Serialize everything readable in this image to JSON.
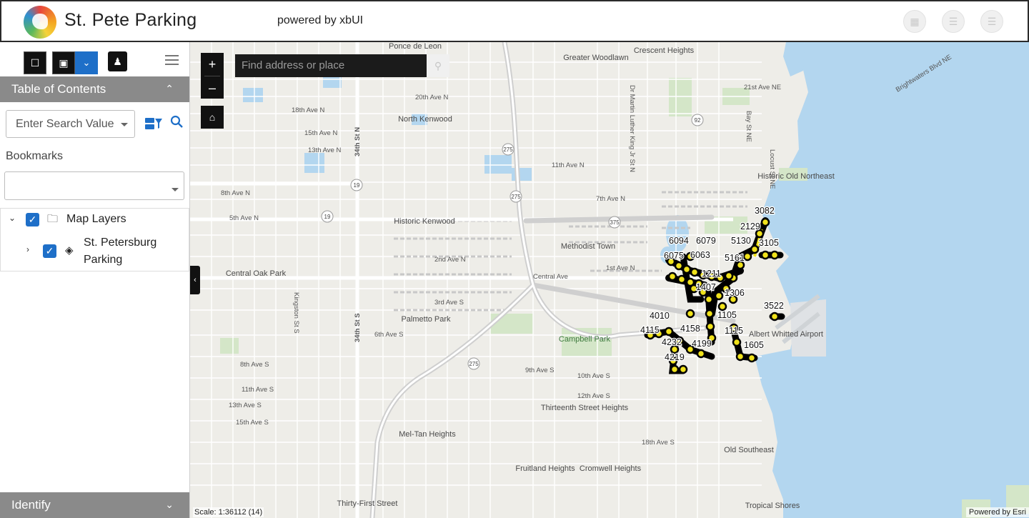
{
  "header": {
    "title": "St. Pete Parking",
    "powered_by": "powered by xbUI",
    "buttons": [
      {
        "icon": "grid-icon"
      },
      {
        "icon": "list-icon"
      },
      {
        "icon": "layers-icon"
      }
    ]
  },
  "toolbar": {
    "icons": [
      "measure-icon",
      "select-icon",
      "chevron-down-icon",
      "person-icon",
      "menu-icon"
    ]
  },
  "toc": {
    "title": "Table of Contents",
    "search_placeholder": "Enter Search Value",
    "bookmarks_label": "Bookmarks",
    "bookmark_value": "",
    "layers": [
      {
        "label": "Map Layers",
        "checked": true,
        "expanded": true
      },
      {
        "label_line1": "St. Petersburg",
        "label_line2": "Parking",
        "checked": true,
        "expanded": false
      }
    ]
  },
  "identify": {
    "title": "Identify"
  },
  "map": {
    "search_placeholder": "Find address or place",
    "zoom_in": "+",
    "zoom_out": "–",
    "scale": "Scale: 1:36112 (14)",
    "attribution": "Powered by Esri",
    "place_labels": [
      "Ponce de Leon",
      "Greater Woodlawn",
      "Crescent Heights",
      "North Kenwood",
      "Historic Old Northeast",
      "Historic Kenwood",
      "Methodist Town",
      "Central Oak Park",
      "Palmetto Park",
      "Campbell Park",
      "Albert Whitted Airport",
      "Thirteenth Street Heights",
      "Mel-Tan Heights",
      "Fruitland Heights",
      "Cromwell Heights",
      "Old Southeast",
      "Thirty-First Street",
      "Tropical Shores"
    ],
    "street_labels": [
      "20th Ave N",
      "18th Ave N",
      "15th Ave N",
      "13th Ave N",
      "11th Ave N",
      "8th Ave N",
      "7th Ave N",
      "5th Ave N",
      "2nd Ave N",
      "1st Ave N",
      "Central Ave",
      "3rd Ave S",
      "6th Ave S",
      "8th Ave S",
      "9th Ave S",
      "10th Ave S",
      "11th Ave S",
      "12th Ave S",
      "13th Ave S",
      "15th Ave S",
      "18th Ave S",
      "21st Ave NE",
      "34th St N",
      "34th St S",
      "Locust St NE",
      "Bay St NE",
      "Brightwaters Blvd NE",
      "Dr Martin Luther King Jr St N",
      "Kingston St S"
    ],
    "route_shields": [
      "275",
      "19",
      "375",
      "92",
      "19",
      "275",
      "275",
      "92"
    ],
    "parking_labels": [
      "3082",
      "2129",
      "5130",
      "3105",
      "6094",
      "6079",
      "6075",
      "6063",
      "5161",
      "1211",
      "1407",
      "1306",
      "3522",
      "4010",
      "1105",
      "4115",
      "4158",
      "1115",
      "4232",
      "4199",
      "1605",
      "4219"
    ]
  },
  "colors": {
    "accent": "#1e6fc8",
    "panel_bar": "#8a8a8a",
    "water": "#b3d6ef",
    "land": "#eeede8",
    "park": "#d4e6c8",
    "parking_point": "#f0e21b"
  }
}
